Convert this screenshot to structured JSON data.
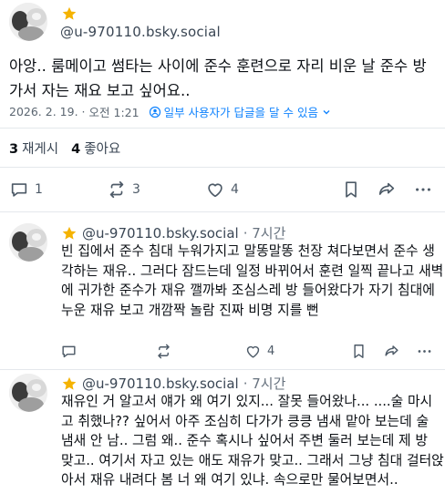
{
  "main_post": {
    "handle": "@u-970110.bsky.social",
    "text": "아앙.. 룸메이고 썸타는 사이에 준수 훈련으로 자리 비운 날 준수 방 가서 자는 재요 보고 싶어요..",
    "date": "2026. 2. 19.",
    "time": "오전 1:21",
    "reply_permission": "일부 사용자가 답글을 달 수 있음",
    "stats": {
      "reposts_count": "3",
      "reposts_label": "재게시",
      "likes_count": "4",
      "likes_label": "좋아요"
    },
    "actions": {
      "replies": "1",
      "reposts": "3",
      "likes": "4"
    }
  },
  "replies": [
    {
      "handle": "@u-970110.bsky.social",
      "time": "· 7시간",
      "text": "빈 집에서 준수 침대 누워가지고 말똥말똥 천장 쳐다보면서 준수 생각하는 재유.. 그러다 잠드는데 일정 바뀌어서 훈련 일찍 끝나고 새벽에 귀가한 준수가 재유 깰까봐 조심스레 방 들어왔다가 자기 침대에 누운 재유 보고 개깜짝 놀람 진짜 비명 지를 뻔",
      "actions": {
        "replies": "",
        "reposts": "",
        "likes": "4"
      }
    },
    {
      "handle": "@u-970110.bsky.social",
      "time": "· 7시간",
      "text": "재유인 거 알고서 얘가 왜 여기 있지... 잘못 들어왔나... ....술 마시고 취했나?? 싶어서 아주 조심히 다가가 킁킁 냄새 맡아 보는데 술 냄새 안 남.. 그럼 왜.. 준수 혹시나 싶어서 주변 둘러 보는데 제 방 맞고.. 여기서 자고 있는 애도 재유가 맞고.. 그래서 그냥 침대 걸터앉아서 재유 내려다 봄 너 왜 여기 있냐. 속으로만 물어보면서.."
    }
  ],
  "colors": {
    "link_blue": "#1083fe",
    "star_gold": "#f5b301",
    "divider": "#e4e8ec"
  },
  "icons": [
    "star-icon",
    "reply-icon",
    "repost-icon",
    "like-icon",
    "bookmark-icon",
    "share-icon",
    "more-icon",
    "reply-permission-icon",
    "chevron-down-icon"
  ]
}
